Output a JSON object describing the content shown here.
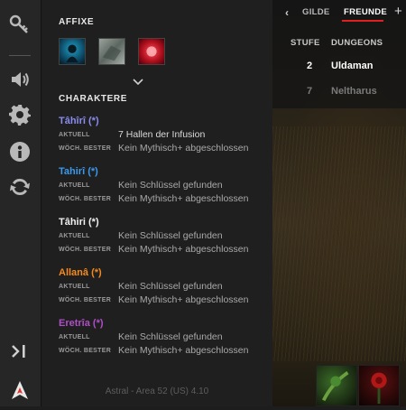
{
  "sidebar": {
    "icons": [
      "key-icon",
      "speaker-icon",
      "gear-icon",
      "info-icon",
      "sync-icon",
      "collapse-icon",
      "astral-logo-icon"
    ]
  },
  "affixes": {
    "title": "AFFIXE",
    "items": [
      {
        "name": "affix-1-icon",
        "color": "#1a6a8a"
      },
      {
        "name": "affix-2-icon",
        "color": "#8a8f8a"
      },
      {
        "name": "affix-3-icon",
        "color": "#b0202a"
      }
    ]
  },
  "characters": {
    "title": "CHARAKTERE",
    "label_current": "AKTUELL",
    "label_weekly": "WÖCH. BESTER",
    "list": [
      {
        "name": "Tâhîrî (*)",
        "color": "#8a8cf0",
        "current": "7 Hallen der Infusion",
        "weekly": "Kein Mythisch+ abgeschlossen"
      },
      {
        "name": "Tahirî (*)",
        "color": "#3a9aee",
        "current": "Kein Schlüssel gefunden",
        "weekly": "Kein Mythisch+ abgeschlossen"
      },
      {
        "name": "Tâhiri (*)",
        "color": "#f0f0f0",
        "current": "Kein Schlüssel gefunden",
        "weekly": "Kein Mythisch+ abgeschlossen"
      },
      {
        "name": "Allanâ (*)",
        "color": "#f58a1e",
        "current": "Kein Schlüssel gefunden",
        "weekly": "Kein Mythisch+ abgeschlossen"
      },
      {
        "name": "Eretrîa (*)",
        "color": "#b04ec8",
        "current": "Kein Schlüssel gefunden",
        "weekly": "Kein Mythisch+ abgeschlossen"
      }
    ]
  },
  "footer": "Astral - Area 52 (US) 4.10",
  "tabs": {
    "prev": "‹",
    "guild": "GILDE",
    "friends": "FREUNDE",
    "add": "+"
  },
  "friends": {
    "col_level": "STUFE",
    "col_dungeon": "DUNGEONS",
    "rows": [
      {
        "level": "2",
        "dungeon": "Uldaman",
        "color": "#ffffff"
      },
      {
        "level": "7",
        "dungeon": "Neltharus",
        "color": "#7a7a7a"
      }
    ]
  }
}
